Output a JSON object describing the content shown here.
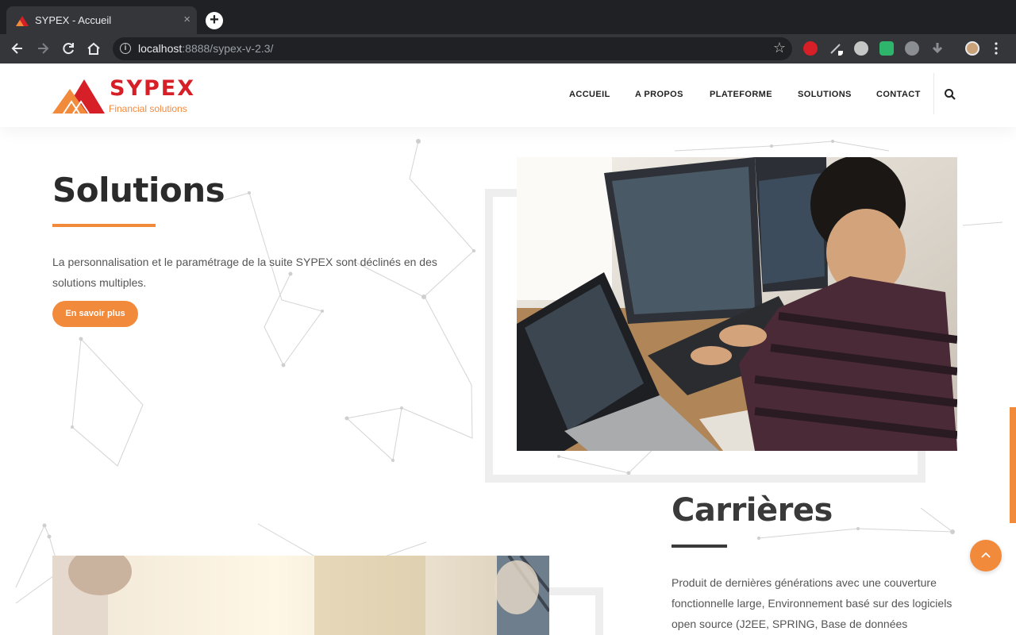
{
  "browser": {
    "tab_title": "SYPEX - Accueil",
    "tab_close": "×",
    "new_tab": "+",
    "url_host": "localhost",
    "url_path": ":8888/sypex-v-2.3/"
  },
  "header": {
    "logo_text": "SYPEX",
    "logo_subtitle": "Financial solutions",
    "nav": [
      "ACCUEIL",
      "A PROPOS",
      "PLATEFORME",
      "SOLUTIONS",
      "CONTACT"
    ]
  },
  "solutions": {
    "title": "Solutions",
    "text": "La personnalisation et le paramétrage de la suite SYPEX sont déclinés en des solutions multiples.",
    "button": "En savoir plus"
  },
  "careers": {
    "title": "Carrières",
    "text": "Produit de dernières générations avec une couverture fonctionnelle large, Environnement basé sur des logiciels open source (J2EE, SPRING, Base de données"
  },
  "colors": {
    "accent": "#f28a3c",
    "brand_red": "#d61f26",
    "heading": "#2b2b2b"
  },
  "icons": [
    "back-arrow-icon",
    "forward-arrow-icon",
    "reload-icon",
    "home-icon",
    "info-icon",
    "star-icon",
    "search-icon",
    "chevron-up-icon",
    "kebab-menu-icon"
  ]
}
